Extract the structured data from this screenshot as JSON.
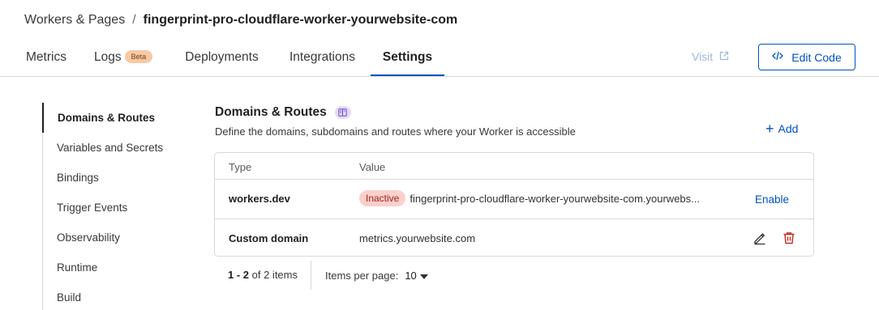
{
  "breadcrumb": {
    "parent": "Workers & Pages",
    "separator": "/",
    "current": "fingerprint-pro-cloudflare-worker-yourwebsite-com"
  },
  "tabs": [
    {
      "label": "Metrics"
    },
    {
      "label": "Logs",
      "badge": "Beta"
    },
    {
      "label": "Deployments"
    },
    {
      "label": "Integrations"
    },
    {
      "label": "Settings",
      "active": true
    }
  ],
  "header_actions": {
    "visit_label": "Visit",
    "edit_code_label": "Edit Code"
  },
  "sidebar": {
    "items": [
      {
        "label": "Domains & Routes",
        "active": true
      },
      {
        "label": "Variables and Secrets"
      },
      {
        "label": "Bindings"
      },
      {
        "label": "Trigger Events"
      },
      {
        "label": "Observability"
      },
      {
        "label": "Runtime"
      },
      {
        "label": "Build"
      }
    ]
  },
  "section": {
    "title": "Domains & Routes",
    "description": "Define the domains, subdomains and routes where your Worker is accessible",
    "add_label": "Add"
  },
  "table": {
    "columns": [
      "Type",
      "Value"
    ],
    "rows": [
      {
        "type": "workers.dev",
        "status": "Inactive",
        "value": "fingerprint-pro-cloudflare-worker-yourwebsite-com.yourwebs...",
        "action": "Enable"
      },
      {
        "type": "Custom domain",
        "value": "metrics.yourwebsite.com"
      }
    ]
  },
  "pagination": {
    "range": "1 - 2",
    "of_text": "of 2 items",
    "per_page_label": "Items per page:",
    "per_page_value": "10"
  },
  "colors": {
    "accent": "#0051c3",
    "danger": "#c12d1f",
    "inactive_badge_bg": "#fbcfcb",
    "beta_badge_bg": "#f6c9a5"
  },
  "icons": {
    "visit": "external-link-icon",
    "edit_code": "code-icon",
    "add": "plus-icon",
    "edit_row": "pencil-icon",
    "delete_row": "trash-icon",
    "docs": "book-icon",
    "per_page": "caret-down-icon"
  }
}
